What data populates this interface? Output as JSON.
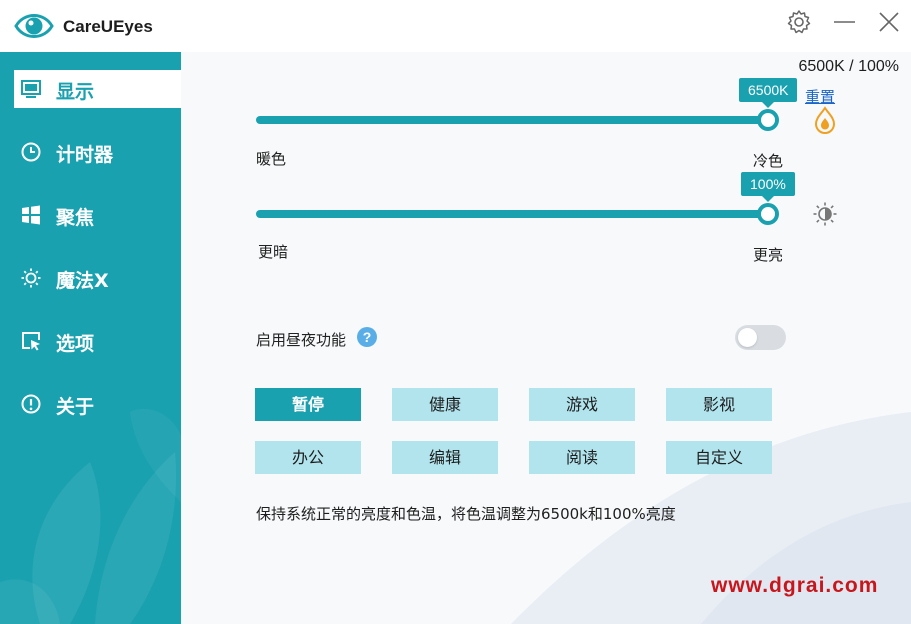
{
  "app": {
    "title": "CareUEyes"
  },
  "titlebar": {
    "settings_icon": "gear-icon",
    "minimize_icon": "minimize-icon",
    "close_icon": "close-icon"
  },
  "sidebar": {
    "items": [
      {
        "label": "显示",
        "icon": "monitor-icon",
        "active": true
      },
      {
        "label": "计时器",
        "icon": "clock-icon",
        "active": false
      },
      {
        "label": "聚焦",
        "icon": "windows-icon",
        "active": false
      },
      {
        "label": "魔法X",
        "icon": "sun-icon",
        "active": false
      },
      {
        "label": "选项",
        "icon": "window-cursor-icon",
        "active": false
      },
      {
        "label": "关于",
        "icon": "info-icon",
        "active": false
      }
    ]
  },
  "display": {
    "status": "6500K / 100%",
    "reset_label": "重置",
    "color_temp": {
      "value_label": "6500K",
      "fraction": 1.0,
      "left_label": "暖色",
      "right_label": "冷色",
      "icon": "flame-icon"
    },
    "brightness": {
      "value_label": "100%",
      "fraction": 1.0,
      "left_label": "更暗",
      "right_label": "更亮",
      "icon": "brightness-icon"
    },
    "daynight": {
      "label": "启用昼夜功能",
      "enabled": false,
      "help_icon": "help-icon"
    },
    "modes": [
      {
        "label": "暂停",
        "active": true
      },
      {
        "label": "健康",
        "active": false
      },
      {
        "label": "游戏",
        "active": false
      },
      {
        "label": "影视",
        "active": false
      },
      {
        "label": "办公",
        "active": false
      },
      {
        "label": "编辑",
        "active": false
      },
      {
        "label": "阅读",
        "active": false
      },
      {
        "label": "自定义",
        "active": false
      }
    ],
    "description": "保持系统正常的亮度和色温，将色温调整为6500k和100%亮度"
  },
  "watermark": "www.dgrai.com",
  "colors": {
    "accent": "#1aa1b0",
    "mode_button": "#b2e4ee",
    "link": "#1b64c8",
    "watermark": "#c8171c"
  }
}
